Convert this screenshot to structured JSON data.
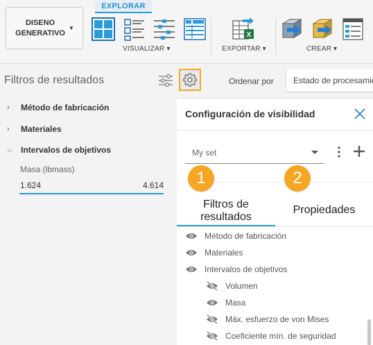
{
  "toolbar": {
    "design_button": "DISENO GENERATIVO",
    "explore_tab": "EXPLORAR",
    "groups": {
      "visualize": "VISUALIZAR",
      "export": "EXPORTAR",
      "create": "CREAR"
    },
    "icons": [
      "grid-view-icon",
      "list-view-icon",
      "detail-list-icon",
      "table-view-icon",
      "excel-export-icon",
      "create-design-icon",
      "create-model-icon",
      "create-report-icon"
    ]
  },
  "left_panel": {
    "title": "Filtros de resultados",
    "items": [
      {
        "label": "Método de fabricación",
        "expanded": false
      },
      {
        "label": "Materiales",
        "expanded": false
      },
      {
        "label": "Intervalos de objetivos",
        "expanded": true
      }
    ],
    "range": {
      "label": "Masa (lbmass)",
      "min": "1.624",
      "max": "4.614"
    }
  },
  "sort": {
    "label": "Ordenar por",
    "value": "Estado de procesamiento"
  },
  "visibility": {
    "title": "Configuración de visibilidad",
    "set_value": "My set",
    "badges": [
      "1",
      "2"
    ],
    "tabs": [
      "Filtros de resultados",
      "Propiedades"
    ],
    "active_tab": 0,
    "rows": [
      {
        "label": "Método de fabricación",
        "visible": true,
        "indent": false
      },
      {
        "label": "Materiales",
        "visible": true,
        "indent": false
      },
      {
        "label": "Intervalos de objetivos",
        "visible": true,
        "indent": false
      },
      {
        "label": "Volumen",
        "visible": false,
        "indent": true
      },
      {
        "label": "Masa",
        "visible": true,
        "indent": true
      },
      {
        "label": "Máx. esfuerzo de von Mises",
        "visible": false,
        "indent": true
      },
      {
        "label": "Coeficiente mín. de seguridad",
        "visible": false,
        "indent": true
      }
    ]
  },
  "colors": {
    "accent": "#2a9bd6",
    "highlight": "#f5a623"
  }
}
